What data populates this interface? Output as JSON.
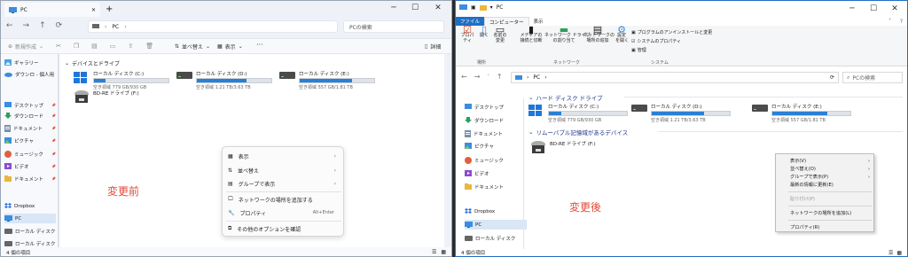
{
  "left": {
    "tab_title": "PC",
    "tab_add": "+",
    "win_min": "─",
    "win_max": "☐",
    "win_close": "✕",
    "address_path": "PC",
    "address_sep": "›",
    "search_placeholder": "PCの検索",
    "cmd": {
      "new": "新規作成",
      "sort": "並べ替え",
      "view": "表示",
      "more": "···",
      "details": "詳細"
    },
    "nav": [
      {
        "label": "ギャラリー",
        "pin": false,
        "icon": "gallery"
      },
      {
        "label": "ダウンロ - 個人用",
        "pin": false,
        "icon": "cloud"
      },
      {
        "label": "デスクトップ",
        "pin": true,
        "icon": "desktop"
      },
      {
        "label": "ダウンロード",
        "pin": true,
        "icon": "download"
      },
      {
        "label": "ドキュメント",
        "pin": true,
        "icon": "doc"
      },
      {
        "label": "ピクチャ",
        "pin": true,
        "icon": "picture"
      },
      {
        "label": "ミュージック",
        "pin": true,
        "icon": "music"
      },
      {
        "label": "ビデオ",
        "pin": true,
        "icon": "video"
      },
      {
        "label": "ドキュメント",
        "pin": true,
        "icon": "folder"
      },
      {
        "label": "Dropbox",
        "pin": false,
        "icon": "dropbox"
      },
      {
        "label": "PC",
        "pin": false,
        "icon": "pc"
      },
      {
        "label": "ローカル ディスク",
        "pin": false,
        "icon": "disk"
      },
      {
        "label": "ローカル ディスク",
        "pin": false,
        "icon": "disk"
      }
    ],
    "group_header": "デバイスとドライブ",
    "drives": [
      {
        "name": "ローカル ディスク (C:)",
        "space": "空き領域 779 GB/930 GB",
        "used": 0.16
      },
      {
        "name": "ローカル ディスク (D:)",
        "space": "空き領域 1.21 TB/3.63 TB",
        "used": 0.67
      },
      {
        "name": "ローカル ディスク (E:)",
        "space": "空き領域 557 GB/1.81 TB",
        "used": 0.7
      }
    ],
    "bd": "BD-RE ドライブ (F:)",
    "status": "4 個の項目",
    "caption": "変更前",
    "context": {
      "view": "表示",
      "sort": "並べ替え",
      "group": "グループで表示",
      "netloc": "ネットワークの場所を追加する",
      "props": "プロパティ",
      "props_key": "Alt+Enter",
      "more": "その他のオプションを確認"
    }
  },
  "right": {
    "title": "PC",
    "win_min": "─",
    "win_max": "☐",
    "win_close": "✕",
    "ribbon_tabs": [
      "ファイル",
      "コンピューター",
      "表示"
    ],
    "ribbon": {
      "props": "プロパティ",
      "open": "開く",
      "rename": "名前の\n変更",
      "media": "メディアの\n接続と切断",
      "mapdrive": "ネットワーク ドライブ\nの割り当て",
      "addnet": "ネットワークの\n場所の追加",
      "settings": "設定\nを開く",
      "uninstall": "プログラムのアンインストールと変更",
      "sysprops": "システムのプロパティ",
      "manage": "管理",
      "grp_location": "場所",
      "grp_network": "ネットワーク",
      "grp_system": "システム"
    },
    "address_path": "PC",
    "address_sep": "›",
    "search_placeholder": "PCの検索",
    "nav": [
      {
        "label": "デスクトップ",
        "icon": "desktop"
      },
      {
        "label": "ダウンロード",
        "icon": "download"
      },
      {
        "label": "ドキュメント",
        "icon": "doc"
      },
      {
        "label": "ピクチャ",
        "icon": "picture"
      },
      {
        "label": "ミュージック",
        "icon": "music"
      },
      {
        "label": "ビデオ",
        "icon": "video"
      },
      {
        "label": "ドキュメント",
        "icon": "folder"
      },
      {
        "label": "Dropbox",
        "icon": "dropbox"
      },
      {
        "label": "PC",
        "icon": "pc"
      },
      {
        "label": "ローカル ディスク",
        "icon": "disk"
      }
    ],
    "group_hdd": "ハード ディスク ドライブ",
    "group_removable": "リムーバブル記憶域があるデバイス",
    "drives": [
      {
        "name": "ローカル ディスク (C:)",
        "space": "空き領域 779 GB/930 GB",
        "used": 0.16
      },
      {
        "name": "ローカル ディスク (D:)",
        "space": "空き領域 1.21 TB/3.63 TB",
        "used": 0.67
      },
      {
        "name": "ローカル ディスク (E:)",
        "space": "空き領域 557 GB/1.81 TB",
        "used": 0.7
      }
    ],
    "bd": "BD-RE ドライブ (F:)",
    "status": "4 個の項目",
    "caption": "変更後",
    "context": {
      "view": "表示(V)",
      "sort": "並べ替え(O)",
      "group": "グループで表示(P)",
      "refresh": "最新の情報に更新(E)",
      "paste": "貼り付け(P)",
      "netloc": "ネットワークの場所を追加(L)",
      "props": "プロパティ(R)"
    }
  },
  "colors": {
    "accent": "#2b7fd4",
    "caption": "#e04a3c",
    "titleblue": "#1e3287"
  }
}
